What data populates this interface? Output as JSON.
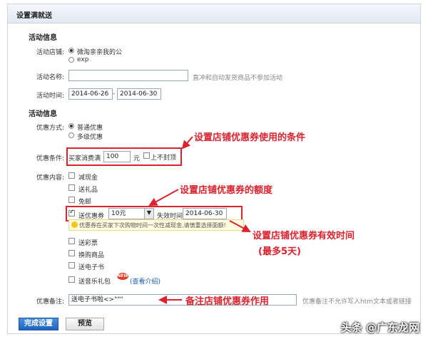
{
  "title": "设置满就送",
  "section1_title": "活动信息",
  "store": {
    "label": "活动店铺:",
    "options": [
      "微淘亲亲我的公",
      "exp"
    ]
  },
  "name": {
    "label": "活动名称:",
    "value": "",
    "hint": "直冲和自动发货商品不参加活动"
  },
  "time": {
    "label": "活动时间:",
    "start": "2014-06-26",
    "sep": "-",
    "end": "2014-06-30"
  },
  "section2_title": "活动信息",
  "method": {
    "label": "优惠方式:",
    "options": [
      "普通优惠",
      "多级优惠"
    ]
  },
  "condition": {
    "label": "优惠条件:",
    "prefix": "买家消费满",
    "amount": "100",
    "unit": "元",
    "no_cap": "上不封顶"
  },
  "content": {
    "label": "优惠内容:",
    "items": [
      "减现金",
      "送礼品",
      "免邮"
    ],
    "coupon_label": "送优惠券",
    "coupon_value": "10元",
    "expire_label": "失效时间",
    "expire_value": "2014-06-30",
    "tip": "优惠券在买家下次购物时间一次性减现金,请慎重选择面额!",
    "items2": [
      "送彩票",
      "换购商品",
      "送电子书",
      "送音乐礼包"
    ],
    "new_badge": "NEW",
    "view_intro": "(查看介绍)"
  },
  "remark": {
    "label": "优惠备注:",
    "value": "送电子书啦<>\"\"\"",
    "hint": "优惠备注不允许写入htm文本或者链接"
  },
  "buttons": {
    "save": "完成设置",
    "preview": "预览"
  },
  "annotations": {
    "a1": "设置店铺优惠券使用的条件",
    "a2": "设置店铺优惠券的额度",
    "a3": "设置店铺优惠券有效时间",
    "a3b": "(最多5天)",
    "a4": "备注店铺优惠券作用"
  },
  "watermark": "头条 @广东龙网"
}
